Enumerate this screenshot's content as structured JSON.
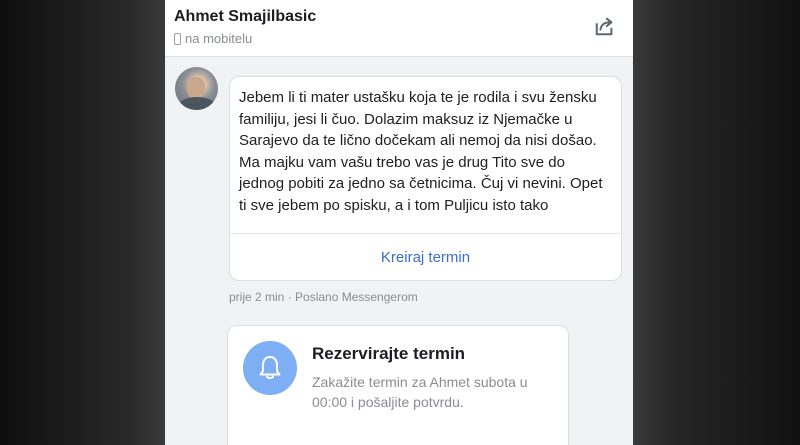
{
  "header": {
    "contact_name": "Ahmet Smajilbasic",
    "status": "na mobitelu",
    "share_icon": "share-icon"
  },
  "message": {
    "text": "Jebem li ti mater ustašku koja te je rodila i svu žensku familiju, jesi li čuo. Dolazim maksuz iz Njemačke u Sarajevo da te lično dočekam ali nemoj da nisi došao. Ma majku vam vašu trebo vas je drug Tito sve do jednog pobiti za jedno sa četnicima. Čuj vi nevini. Opet ti sve jebem po spisku, a i tom Puljicu isto tako",
    "action_label": "Kreiraj termin",
    "meta": "prije 2 min · Poslano Messengerom"
  },
  "reservation": {
    "title": "Rezervirajte termin",
    "description": "Zakažite termin za Ahmet subota u 00:00 i pošaljite potvrdu.",
    "icon": "bell-icon"
  },
  "colors": {
    "link_blue": "#3b6ec7",
    "bell_bg": "#7eaef4",
    "page_bg": "#f1f2f4"
  }
}
